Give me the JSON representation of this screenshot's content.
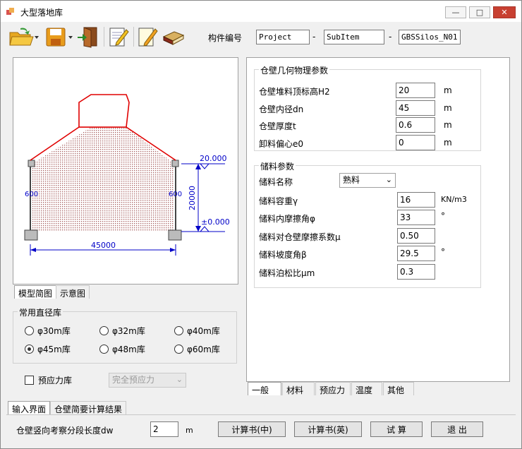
{
  "window": {
    "title": "大型落地库",
    "controls": {
      "minimize": "—",
      "maximize": "□",
      "close": "✕"
    }
  },
  "toolbar": {
    "icons": [
      "open-folder-icon",
      "save-icon",
      "exit-door-icon",
      "notepad-icon",
      "edit-pencil-icon",
      "book-icon"
    ],
    "component_label": "构件编号",
    "project": "Project",
    "subitem": "SubItem",
    "silo": "GBSSilos_N01",
    "dash": "-"
  },
  "diagram": {
    "top_elev": "20.000",
    "base_elev": "±0.000",
    "height": "20000",
    "width": "45000",
    "wall_left": "600",
    "wall_right": "600"
  },
  "left_tabs": {
    "model": "模型简图",
    "sketch": "示意图"
  },
  "common_diam": {
    "title": "常用直径库",
    "options": [
      {
        "label": "φ30m库",
        "checked": false
      },
      {
        "label": "φ32m库",
        "checked": false
      },
      {
        "label": "φ40m库",
        "checked": false
      },
      {
        "label": "φ45m库",
        "checked": true
      },
      {
        "label": "φ48m库",
        "checked": false
      },
      {
        "label": "φ60m库",
        "checked": false
      }
    ]
  },
  "prestress": {
    "label": "预应力库",
    "select": "完全预应力"
  },
  "geometry": {
    "title": "仓壁几何物理参数",
    "rows": [
      {
        "label": "仓壁堆料顶标高H2",
        "value": "20",
        "unit": "m"
      },
      {
        "label": "仓壁内径dn",
        "value": "45",
        "unit": "m"
      },
      {
        "label": "仓壁厚度t",
        "value": "0.6",
        "unit": "m"
      },
      {
        "label": "卸料偏心e0",
        "value": "0",
        "unit": "m"
      }
    ]
  },
  "storage": {
    "title": "储料参数",
    "name_label": "储料名称",
    "name_value": "熟料",
    "rows": [
      {
        "label": "储料容重γ",
        "value": "16",
        "unit": "KN/m3"
      },
      {
        "label": "储料内摩擦角φ",
        "value": "33",
        "unit": "°"
      },
      {
        "label": "储料对仓壁摩擦系数μ",
        "value": "0.50",
        "unit": ""
      },
      {
        "label": "储料坡度角β",
        "value": "29.5",
        "unit": "°"
      },
      {
        "label": "储料泊松比μm",
        "value": "0.3",
        "unit": ""
      }
    ]
  },
  "right_tabs": [
    "一般",
    "材料",
    "预应力",
    "温度",
    "其他"
  ],
  "bottom_tabs": {
    "input": "输入界面",
    "result": "仓壁简要计算结果"
  },
  "segment": {
    "label": "仓壁竖向考察分段长度dw",
    "value": "2",
    "unit": "m"
  },
  "buttons": {
    "calc_cn": "计算书(中)",
    "calc_en": "计算书(英)",
    "trial": "试 算",
    "exit": "退 出"
  },
  "colors": {
    "roof": "#e00000",
    "dim": "#0000c8",
    "fill": "#b06060"
  }
}
